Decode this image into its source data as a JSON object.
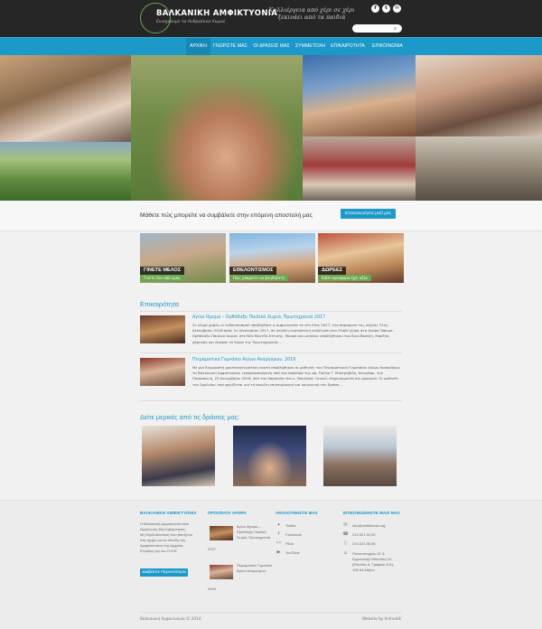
{
  "header": {
    "logo_name": "ΒΑΛΚΑΝΙΚΗ ΑΜΦΙΚΤΥΟΝΙΑ",
    "logo_sub": "Ενισχύουμε τα Ανθρώπινα Χωριά",
    "motto_line1": "Καλλιέργεια από χέρι σε χέρι",
    "motto_line2": "ξεκινάει από τα παιδιά",
    "social_facebook": "f",
    "social_twitter": "t",
    "social_email": "✉",
    "search_placeholder": ""
  },
  "nav": {
    "items": [
      "ΑΡΧΙΚΗ",
      "ΓΝΩΡΙΣΤΕ ΜΑΣ",
      "ΟΙ ΔΡΑΣΕΙΣ ΜΑΣ",
      "ΣΥΜΜΕΤΟΧΗ",
      "ΕΠΙΚΑΙΡΟΤΗΤΑ",
      "ΕΠΙΚΟΙΝΩΝΙΑ"
    ],
    "active": "ΑΡΧΙΚΗ"
  },
  "cta": {
    "text": "Μάθετε πώς μπορείτε να συμβάλετε στην επόμενη αποστολή μας",
    "button": "Επικοινωνήστε μαζί μας"
  },
  "cards": [
    {
      "title": "ΓΙΝΕΤΕ ΜΕΛΟΣ",
      "sub": "Γίνετε ένα από εμάς"
    },
    {
      "title": "ΕΘΕΛΟΝΤΙΣΜΟΣ",
      "sub": "Πώς μπορείτε να βοηθήσετε"
    },
    {
      "title": "ΔΩΡΕΕΣ",
      "sub": "Κάθε προσφορά έχει αξία"
    }
  ],
  "news": {
    "section_title": "Επικαιρότητα",
    "items": [
      {
        "title": "Αγίου Ιδρυμα – Ορθόδοξο Παιδικό Χωριό, Πρωτοχρονιά 2017",
        "body": "Σε κλίμα χαράς κι ενθουσιασμού υποδέχθηκε η Αμφικτυονία το νέο έτος 2017, την παραμονή της νύχτας 31ης Δεκεμβρίου 2016 προς 1η Ιανουαρίου 2017, σε μεγάλη εορταστική εκδήλωση που έλαβε χώρα στο Αγαρο Ίδρυμα - Ορθόδοξο Παιδικό Χωριό, στο Νέο Βουτζά Αττικής. Μικροί και μεγάλοι υποδέχθηκαν τον Άγιο Βασίλη, έπαιξαν, χόρεψαν και έκοψαν το δώρο της Πρωτοχρονιάς…"
      },
      {
        "title": "Πειραματικό Γυμνάσιο Αγίων Αναργύρων, 2016",
        "body": "Με μία ξεχωριστή χριστουγεννιάτικη εορτή υποδέχθηκαν οι μαθητές του Πειραματικού Γυμνασίου Αγίων Αναργύρων τη Βαλκανική Αμφικτυονία, εκπροσωπούμενη από τον πρόεδρό της Δρ. Παύλο Γ. Μιστρήβιδή, διευγάρο, την Παρασκευή, 23 Δεκεμβρίου 2016, υπό την παρουσία του κ. Νικολάου Ξανιού, επιχειρηματία και χορηγού. Οι μαθητές του Σχολείου, που φημίζεται για τη ποικίλη επιστημονική και κοινωνική του δράση…"
      }
    ]
  },
  "activities": {
    "section_title": "Δείτε μερικές από τις δράσεις μας:"
  },
  "footer": {
    "col1_title": "ΒΑΛΚΑΝΙΚΗ ΑΜΦΙΚΤΥΟΝΙΑ",
    "col1_text": "Η Βαλκανική Αμφικτυονία είναι Οργάνωση Μη Κυβερνητική - Μη Κερδοσκοπική που βασίζεται στις αρχές και τα ιδεώδη του Αμφικτυονικού της Αρχαίας Ελλάδας και του Ο.Η.Ε.",
    "col1_button": "Διαβάστε Περισσότερα",
    "col2_title": "ΠΡΟΣΦΑΤΑ ΑΡΘΡΑ",
    "articles": [
      {
        "title": "Αγίου Ιδρυμα – Ορθόδοξο Παιδικό Χωριό, Πρωτοχρονιά",
        "year": "2017"
      },
      {
        "title": "Πειραματικό Γυμνάσιο Αγίων Αναργύρων,",
        "year": "2016"
      }
    ],
    "col3_title": "ΑΚΟΛΟΥΘΗΣΤΕ ΜΑΣ",
    "follow": [
      "Twitter",
      "Facebook",
      "Flickr",
      "YouTube"
    ],
    "col4_title": "ΕΠΙΚΟΙΝΩΝΗΣΤΕ ΜΑΖΙ ΜΑΣ",
    "contact": {
      "email": "info@amfiktionia.org",
      "phone": "210.321.54.92",
      "mobile": "210.321.56.55",
      "address1": "Πανεπιστημίου 57 &",
      "address2": "Εμμανουήλ Μπενάκη 10",
      "address3": "(Είσοδος 6, Γραφείο 414),",
      "address4": "105 64 Αθήνα"
    },
    "copyright": "Βαλκανική Αμφικτυονία © 2014",
    "credit": "Website by Animatik"
  },
  "colors": {
    "accent": "#1c98c9",
    "green": "#6aa84f",
    "header_bg": "#262626"
  }
}
